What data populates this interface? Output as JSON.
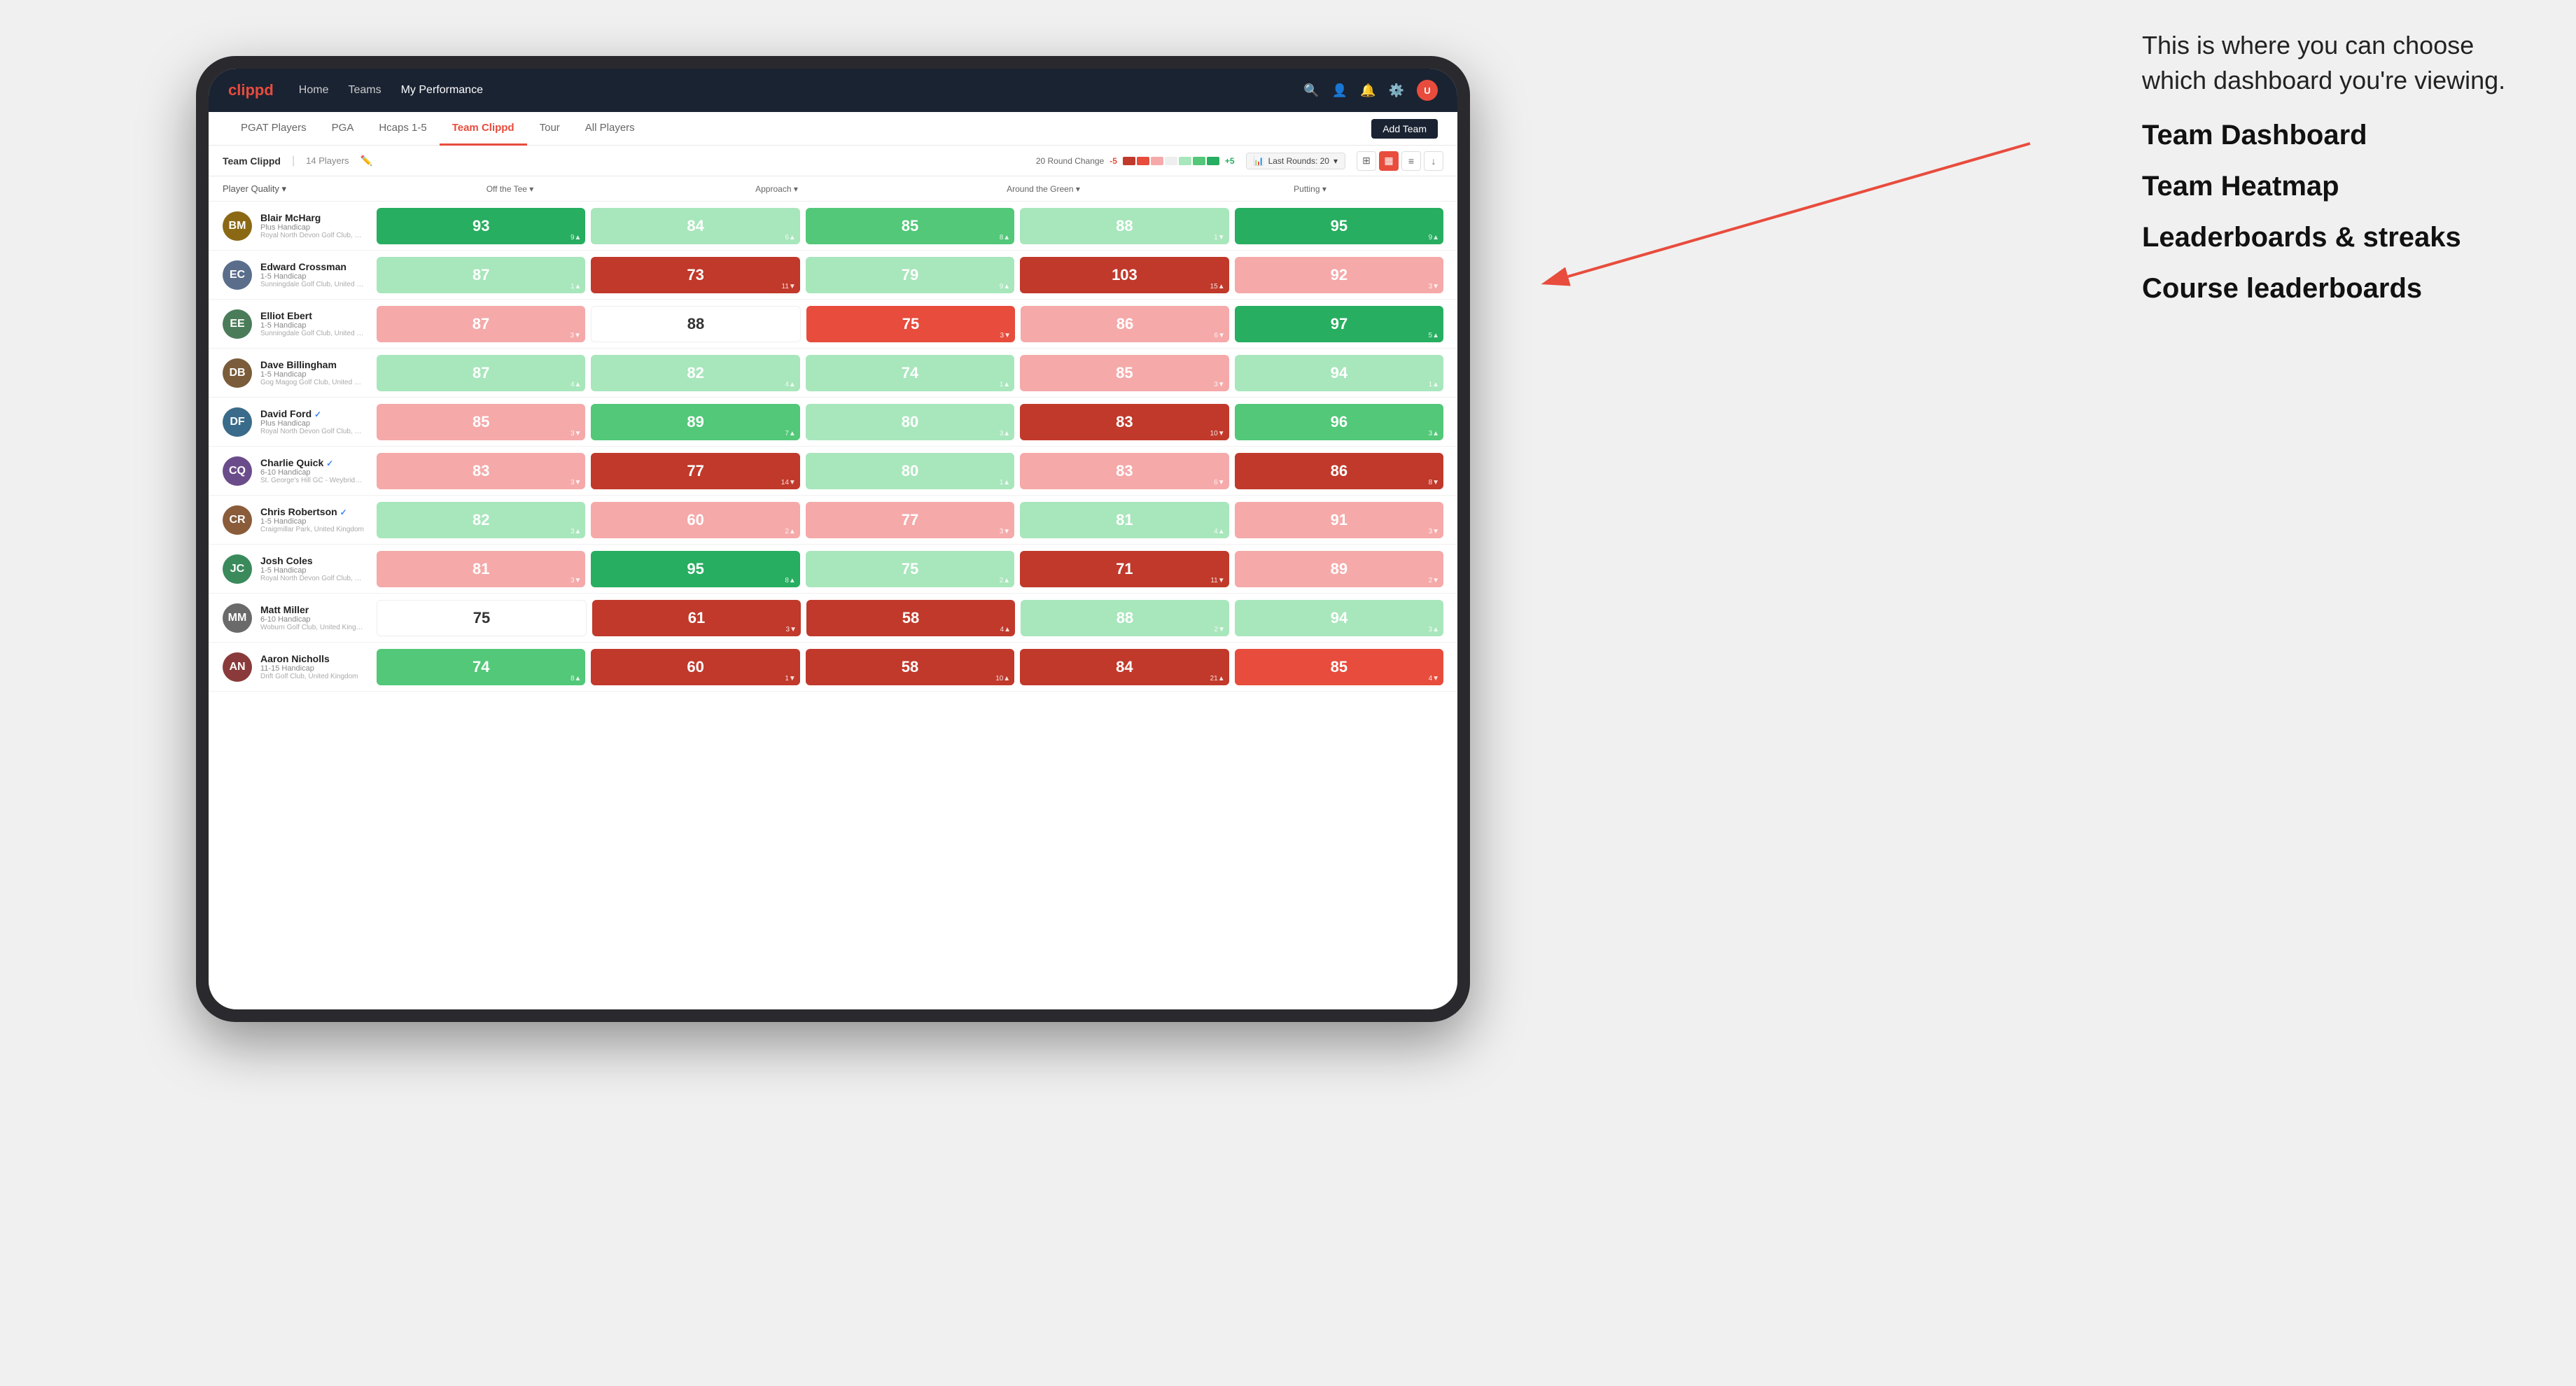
{
  "annotation": {
    "intro": "This is where you can choose which dashboard you're viewing.",
    "options": [
      "Team Dashboard",
      "Team Heatmap",
      "Leaderboards & streaks",
      "Course leaderboards"
    ]
  },
  "nav": {
    "logo": "clippd",
    "links": [
      "Home",
      "Teams",
      "My Performance"
    ],
    "active_link": "My Performance"
  },
  "sub_nav": {
    "links": [
      "PGAT Players",
      "PGA",
      "Hcaps 1-5",
      "Team Clippd",
      "Tour",
      "All Players"
    ],
    "active": "Team Clippd",
    "add_team_label": "Add Team"
  },
  "team_header": {
    "title": "Team Clippd",
    "separator": "|",
    "count": "14 Players",
    "round_change_label": "20 Round Change",
    "round_change_min": "-5",
    "round_change_max": "+5",
    "last_rounds_icon": "📊",
    "last_rounds_label": "Last Rounds:",
    "last_rounds_value": "20"
  },
  "columns": {
    "player_quality": "Player Quality ▾",
    "off_tee": "Off the Tee ▾",
    "approach": "Approach ▾",
    "around_green": "Around the Green ▾",
    "putting": "Putting ▾"
  },
  "players": [
    {
      "name": "Blair McHarg",
      "handicap": "Plus Handicap",
      "club": "Royal North Devon Golf Club, United Kingdom",
      "avatar_color": "#8B6914",
      "initials": "BM",
      "stats": [
        {
          "value": "93",
          "change": "9",
          "dir": "up",
          "color": "green-dark"
        },
        {
          "value": "84",
          "change": "6",
          "dir": "up",
          "color": "green-light"
        },
        {
          "value": "85",
          "change": "8",
          "dir": "up",
          "color": "green-med"
        },
        {
          "value": "88",
          "change": "1",
          "dir": "down",
          "color": "green-light"
        },
        {
          "value": "95",
          "change": "9",
          "dir": "up",
          "color": "green-dark"
        }
      ]
    },
    {
      "name": "Edward Crossman",
      "handicap": "1-5 Handicap",
      "club": "Sunningdale Golf Club, United Kingdom",
      "avatar_color": "#5a6e8c",
      "initials": "EC",
      "stats": [
        {
          "value": "87",
          "change": "1",
          "dir": "up",
          "color": "green-light"
        },
        {
          "value": "73",
          "change": "11",
          "dir": "down",
          "color": "red-dark"
        },
        {
          "value": "79",
          "change": "9",
          "dir": "up",
          "color": "green-light"
        },
        {
          "value": "103",
          "change": "15",
          "dir": "up",
          "color": "red-dark"
        },
        {
          "value": "92",
          "change": "3",
          "dir": "down",
          "color": "red-light"
        }
      ]
    },
    {
      "name": "Elliot Ebert",
      "handicap": "1-5 Handicap",
      "club": "Sunningdale Golf Club, United Kingdom",
      "avatar_color": "#4a7c59",
      "initials": "EE",
      "stats": [
        {
          "value": "87",
          "change": "3",
          "dir": "down",
          "color": "red-light"
        },
        {
          "value": "88",
          "change": "",
          "dir": "neutral",
          "color": "white-cell"
        },
        {
          "value": "75",
          "change": "3",
          "dir": "down",
          "color": "red-med"
        },
        {
          "value": "86",
          "change": "6",
          "dir": "down",
          "color": "red-light"
        },
        {
          "value": "97",
          "change": "5",
          "dir": "up",
          "color": "green-dark"
        }
      ]
    },
    {
      "name": "Dave Billingham",
      "handicap": "1-5 Handicap",
      "club": "Gog Magog Golf Club, United Kingdom",
      "avatar_color": "#7a5c3a",
      "initials": "DB",
      "stats": [
        {
          "value": "87",
          "change": "4",
          "dir": "up",
          "color": "green-light"
        },
        {
          "value": "82",
          "change": "4",
          "dir": "up",
          "color": "green-light"
        },
        {
          "value": "74",
          "change": "1",
          "dir": "up",
          "color": "green-light"
        },
        {
          "value": "85",
          "change": "3",
          "dir": "down",
          "color": "red-light"
        },
        {
          "value": "94",
          "change": "1",
          "dir": "up",
          "color": "green-light"
        }
      ]
    },
    {
      "name": "David Ford",
      "handicap": "Plus Handicap",
      "club": "Royal North Devon Golf Club, United Kingdom",
      "avatar_color": "#3a6b8a",
      "initials": "DF",
      "verified": true,
      "stats": [
        {
          "value": "85",
          "change": "3",
          "dir": "down",
          "color": "red-light"
        },
        {
          "value": "89",
          "change": "7",
          "dir": "up",
          "color": "green-med"
        },
        {
          "value": "80",
          "change": "3",
          "dir": "up",
          "color": "green-light"
        },
        {
          "value": "83",
          "change": "10",
          "dir": "down",
          "color": "red-dark"
        },
        {
          "value": "96",
          "change": "3",
          "dir": "up",
          "color": "green-med"
        }
      ]
    },
    {
      "name": "Charlie Quick",
      "handicap": "6-10 Handicap",
      "club": "St. George's Hill GC - Weybridge - Surrey, Uni...",
      "avatar_color": "#6b4c8a",
      "initials": "CQ",
      "verified": true,
      "stats": [
        {
          "value": "83",
          "change": "3",
          "dir": "down",
          "color": "red-light"
        },
        {
          "value": "77",
          "change": "14",
          "dir": "down",
          "color": "red-dark"
        },
        {
          "value": "80",
          "change": "1",
          "dir": "up",
          "color": "green-light"
        },
        {
          "value": "83",
          "change": "6",
          "dir": "down",
          "color": "red-light"
        },
        {
          "value": "86",
          "change": "8",
          "dir": "down",
          "color": "red-dark"
        }
      ]
    },
    {
      "name": "Chris Robertson",
      "handicap": "1-5 Handicap",
      "club": "Craigmillar Park, United Kingdom",
      "avatar_color": "#8a5c3a",
      "initials": "CR",
      "verified": true,
      "stats": [
        {
          "value": "82",
          "change": "3",
          "dir": "up",
          "color": "green-light"
        },
        {
          "value": "60",
          "change": "2",
          "dir": "up",
          "color": "red-light"
        },
        {
          "value": "77",
          "change": "3",
          "dir": "down",
          "color": "red-light"
        },
        {
          "value": "81",
          "change": "4",
          "dir": "up",
          "color": "green-light"
        },
        {
          "value": "91",
          "change": "3",
          "dir": "down",
          "color": "red-light"
        }
      ]
    },
    {
      "name": "Josh Coles",
      "handicap": "1-5 Handicap",
      "club": "Royal North Devon Golf Club, United Kingdom",
      "avatar_color": "#3a8a5c",
      "initials": "JC",
      "stats": [
        {
          "value": "81",
          "change": "3",
          "dir": "down",
          "color": "red-light"
        },
        {
          "value": "95",
          "change": "8",
          "dir": "up",
          "color": "green-dark"
        },
        {
          "value": "75",
          "change": "2",
          "dir": "up",
          "color": "green-light"
        },
        {
          "value": "71",
          "change": "11",
          "dir": "down",
          "color": "red-dark"
        },
        {
          "value": "89",
          "change": "2",
          "dir": "down",
          "color": "red-light"
        }
      ]
    },
    {
      "name": "Matt Miller",
      "handicap": "6-10 Handicap",
      "club": "Woburn Golf Club, United Kingdom",
      "avatar_color": "#6a6a6a",
      "initials": "MM",
      "stats": [
        {
          "value": "75",
          "change": "",
          "dir": "neutral",
          "color": "white-cell"
        },
        {
          "value": "61",
          "change": "3",
          "dir": "down",
          "color": "red-dark"
        },
        {
          "value": "58",
          "change": "4",
          "dir": "up",
          "color": "red-dark"
        },
        {
          "value": "88",
          "change": "2",
          "dir": "down",
          "color": "green-light"
        },
        {
          "value": "94",
          "change": "3",
          "dir": "up",
          "color": "green-light"
        }
      ]
    },
    {
      "name": "Aaron Nicholls",
      "handicap": "11-15 Handicap",
      "club": "Drift Golf Club, United Kingdom",
      "avatar_color": "#8a3a3a",
      "initials": "AN",
      "stats": [
        {
          "value": "74",
          "change": "8",
          "dir": "up",
          "color": "green-med"
        },
        {
          "value": "60",
          "change": "1",
          "dir": "down",
          "color": "red-dark"
        },
        {
          "value": "58",
          "change": "10",
          "dir": "up",
          "color": "red-dark"
        },
        {
          "value": "84",
          "change": "21",
          "dir": "up",
          "color": "red-dark"
        },
        {
          "value": "85",
          "change": "4",
          "dir": "down",
          "color": "red-med"
        }
      ]
    }
  ]
}
